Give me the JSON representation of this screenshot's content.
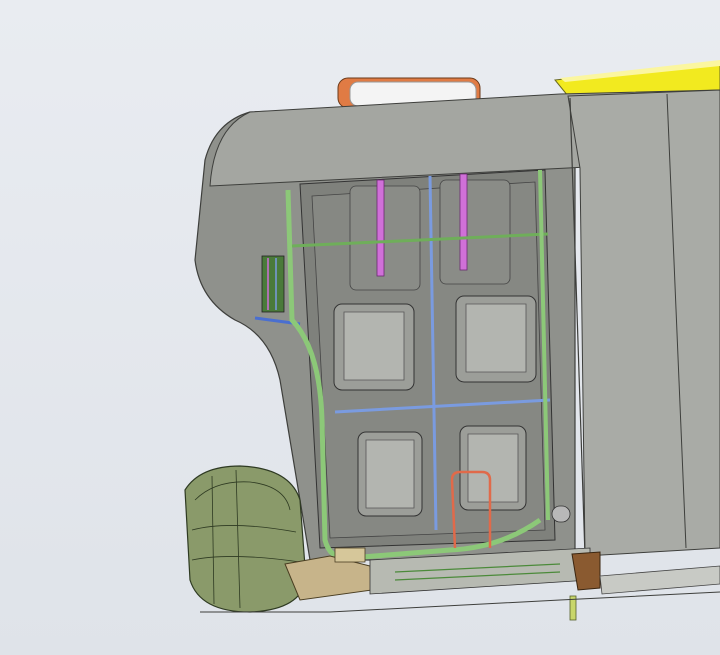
{
  "viewer": {
    "background_top": "#e9ecf1",
    "background_bottom": "#dfe3e9",
    "body_color": "#8f918c",
    "body_dark": "#6e706b",
    "accent_yellow": "#f2ea1f",
    "accent_orange": "#d9743c",
    "pipe_green": "#8cc878",
    "pipe_blue": "#7a9be0",
    "pipe_magenta": "#d070d8",
    "pipe_red": "#e06a4a",
    "mirror_green": "#8a9a6a"
  },
  "model": {
    "parts": [
      "cab-roof",
      "cab-body-panel",
      "rear-wall-frame",
      "storage-compartments",
      "headlamp-housing",
      "yellow-roof-fairing",
      "roof-lamp",
      "green-pipe-routing",
      "blue-pipe-routing",
      "magenta-rods",
      "red-pipe-loop",
      "lower-bracket-assembly",
      "step-bracket"
    ]
  }
}
